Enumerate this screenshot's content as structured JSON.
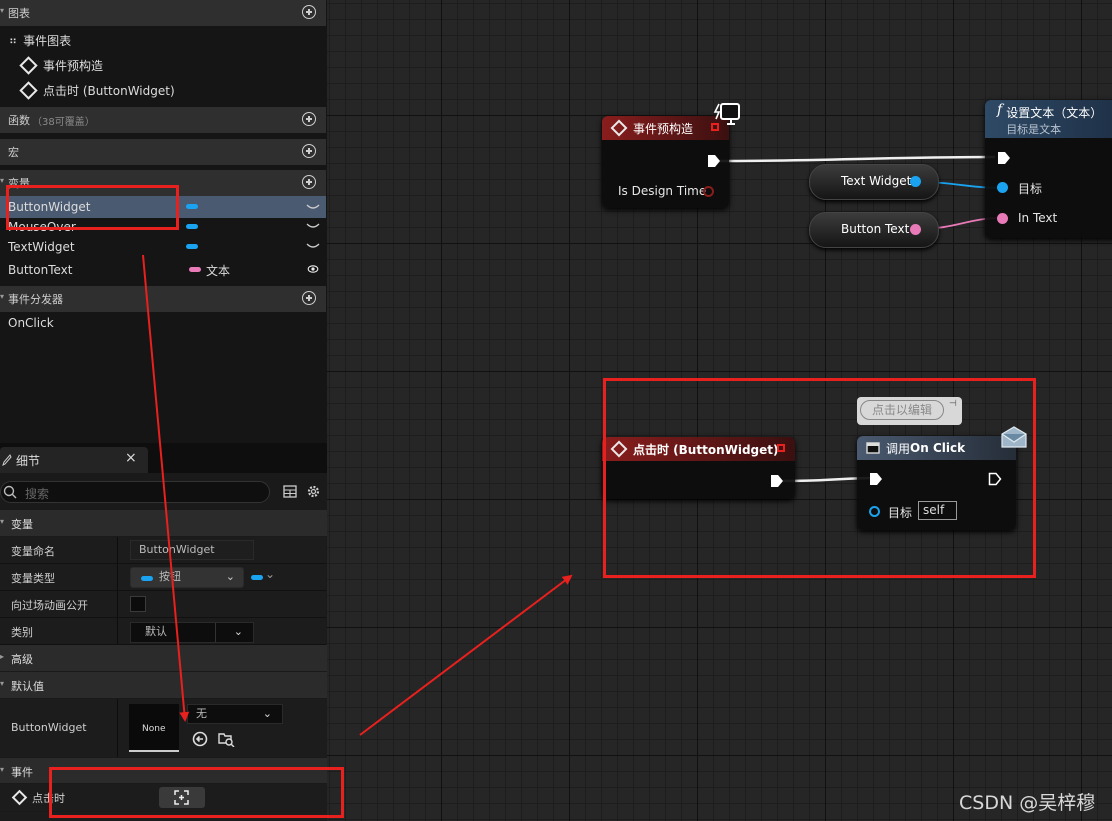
{
  "my_blueprint": {
    "graphs": {
      "header": "图表",
      "items": [
        "事件图表",
        "事件预构造",
        "点击时 (ButtonWidget)"
      ]
    },
    "functions": {
      "header": "函数",
      "count": "（38可覆盖）"
    },
    "macros": {
      "header": "宏"
    },
    "variables": {
      "header": "变量",
      "items": [
        {
          "name": "ButtonWidget",
          "type_color": "#1aa3f0",
          "type_label": ""
        },
        {
          "name": "MouseOver",
          "type_color": "#1aa3f0",
          "type_label": ""
        },
        {
          "name": "TextWidget",
          "type_color": "#1aa3f0",
          "type_label": ""
        },
        {
          "name": "ButtonText",
          "type_color": "#e87ab8",
          "type_label": "文本"
        }
      ]
    },
    "dispatchers": {
      "header": "事件分发器",
      "items": [
        "OnClick"
      ]
    }
  },
  "details": {
    "tab_title": "细节",
    "close": "×",
    "search_placeholder": "搜索",
    "section_variable": "变量",
    "rows": {
      "var_name_label": "变量命名",
      "var_name_value": "ButtonWidget",
      "var_type_label": "变量类型",
      "var_type_value": "按钮",
      "expose_label": "向过场动画公开",
      "category_label": "类别",
      "category_value": "默认"
    },
    "section_advanced": "高级",
    "section_defaults": "默认值",
    "default_label": "ButtonWidget",
    "default_thumb": "None",
    "default_value": "无",
    "section_events": "事件",
    "event_row": "点击时"
  },
  "graph": {
    "preconstruct_node": {
      "title": "事件预构造",
      "pin": "Is Design Time"
    },
    "settext_node": {
      "title": "设置文本（文本）",
      "subtitle": "目标是文本",
      "pin_target": "目标",
      "pin_text": "In Text",
      "func_symbol": "f"
    },
    "get_textwidget": "Text Widget",
    "get_buttontext": "Button Text",
    "onclick_event_node": {
      "title": "点击时 (ButtonWidget)"
    },
    "call_node": {
      "title_prefix": "调用",
      "title_strong": "On Click",
      "pin_target": "目标",
      "self_value": "self",
      "comment": "点击以编辑"
    }
  },
  "watermark": "CSDN @吴梓穆",
  "colors": {
    "exec_white": "#ffffff",
    "object_blue": "#1aa3f0",
    "text_pink": "#e87ab8",
    "event_red": "#8a1d1d",
    "annotation_red": "#e8201e"
  }
}
